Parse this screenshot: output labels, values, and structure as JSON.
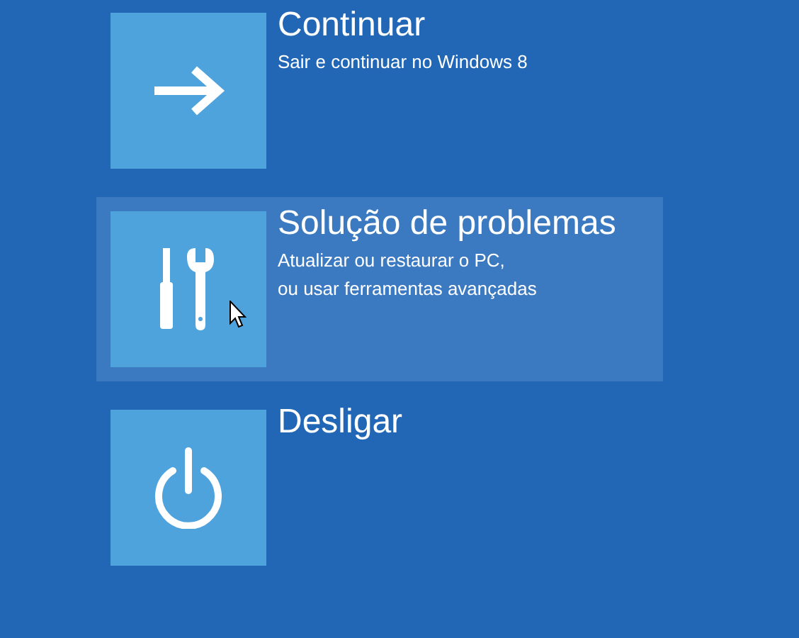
{
  "options": [
    {
      "kind": "arrow",
      "title": "Continuar",
      "description": [
        "Sair e continuar no Windows 8"
      ],
      "selected": false
    },
    {
      "kind": "tools",
      "title": "Solução de problemas",
      "description": [
        "Atualizar ou restaurar o PC,",
        "ou usar ferramentas avançadas"
      ],
      "selected": true
    },
    {
      "kind": "power",
      "title": "Desligar",
      "selected": false
    }
  ]
}
